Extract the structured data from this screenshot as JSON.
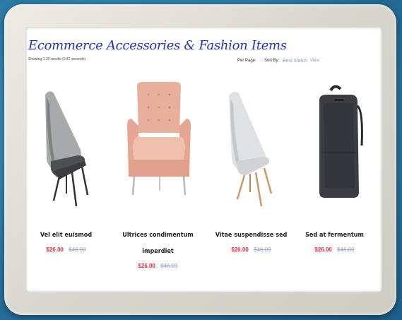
{
  "page": {
    "title": "Ecommerce Accessories & Fashion Items",
    "result_count": "Showing 1-20 results (0.42 seconds)"
  },
  "toolbar": {
    "per_page_label": "Per Page:",
    "sort_by_label": "Sort By:",
    "sort_by_value": "Best Match",
    "view_label": "View"
  },
  "products": [
    {
      "name": "Vel elit euismod",
      "price": "$26.00",
      "old_price": "$46.00",
      "icon": "grey-lounge-chair"
    },
    {
      "name": "Ultrices condimentum imperdiet",
      "price": "$26.00",
      "old_price": "$46.00",
      "icon": "pink-armchair"
    },
    {
      "name": "Vitae suspendisse sed",
      "price": "$26.00",
      "old_price": "$46.00",
      "icon": "white-wood-lounge-chair"
    },
    {
      "name": "Sed at fermentum",
      "price": "$26.00",
      "old_price": "$46.00",
      "icon": "black-backpack"
    }
  ],
  "colors": {
    "title": "#2233bb",
    "price": "#e22e3a",
    "old_price": "#9aa4c4",
    "background": "#2f7fae"
  }
}
